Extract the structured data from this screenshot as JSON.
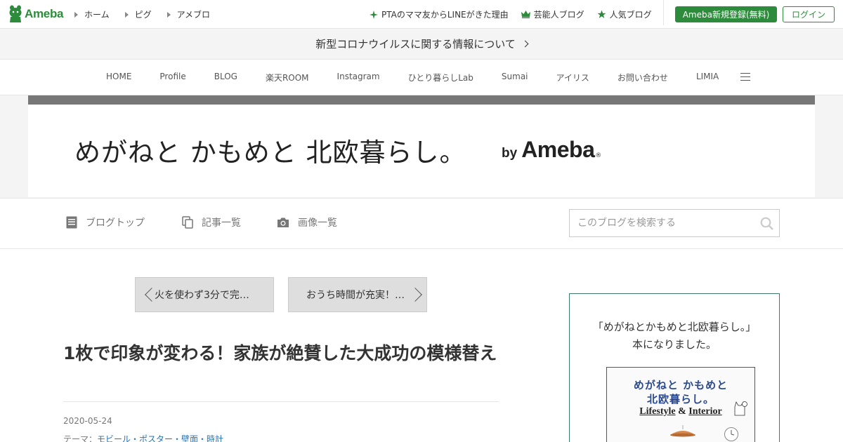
{
  "header": {
    "logo": "Ameba",
    "nav": [
      "ホーム",
      "ピグ",
      "アメブロ"
    ],
    "links": [
      {
        "label": "PTAのママ友からLINEがきた理由",
        "icon": "sparkle-icon"
      },
      {
        "label": "芸能人ブログ",
        "icon": "crown-icon"
      },
      {
        "label": "人気ブログ",
        "icon": "star-icon"
      }
    ],
    "register_label": "Ameba新規登録(無料)",
    "login_label": "ログイン",
    "accent": "#2d8c3c"
  },
  "notice": {
    "text": "新型コロナウイルスに関する情報について"
  },
  "blog_nav": {
    "items": [
      "HOME",
      "Profile",
      "BLOG",
      "楽天ROOM",
      "Instagram",
      "ひとり暮らしLab",
      "Sumai",
      "アイリス",
      "お問い合わせ",
      "LIMIA"
    ],
    "menu_icon": "hamburger-icon"
  },
  "banner": {
    "title": "めがねと かもめと 北欧暮らし。",
    "by": "by",
    "brand": "Ameba",
    "reg": "®"
  },
  "subnav": {
    "items": [
      {
        "label": "ブログトップ",
        "icon": "document-icon"
      },
      {
        "label": "記事一覧",
        "icon": "copy-icon"
      },
      {
        "label": "画像一覧",
        "icon": "camera-icon"
      }
    ],
    "search_placeholder": "このブログを検索する"
  },
  "pager": {
    "prev": "火を使わず3分で完…",
    "next": "おうち時間が充実！…"
  },
  "article": {
    "title": "1枚で印象が変わる！家族が絶賛した大成功の模様替え",
    "date": "2020-05-24",
    "theme_label": "テーマ：",
    "theme": "モビール・ポスター・壁面・時計"
  },
  "sidebar": {
    "line1": "「めがねとかもめと北欧暮らし。」",
    "line2": "本になりました。",
    "book": {
      "line1": "めがねと かもめと",
      "line2": "北欧暮らし。",
      "lifestyle": "Lifestyle",
      "amp": "&",
      "interior": "Interior"
    }
  }
}
